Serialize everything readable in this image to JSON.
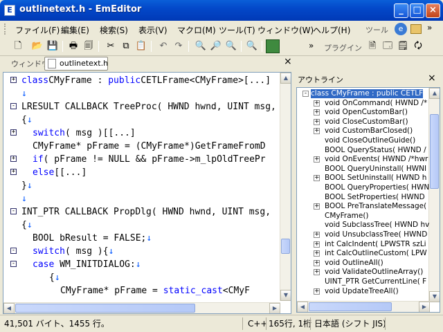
{
  "window": {
    "title": "outlinetext.h - EmEditor"
  },
  "menu": [
    "ファイル(F)",
    "編集(E)",
    "検索(S)",
    "表示(V)",
    "マクロ(M)",
    "ツール(T)",
    "ウィンドウ(W)",
    "ヘルプ(H)"
  ],
  "toolbar_labels": {
    "tool": "ツール",
    "plugin": "プラグイン",
    "more": "»"
  },
  "tabbar": {
    "label": "ウィンドウ",
    "tab": "outlinetext.h",
    "close": "×"
  },
  "outline": {
    "title": "アウトライン",
    "close": "×"
  },
  "code": [
    {
      "fold": "+",
      "parts": [
        [
          "kw",
          "class"
        ],
        [
          "",
          "CMyFrame : "
        ],
        [
          "kw",
          "public"
        ],
        [
          "",
          "CETLFrame<CMyFrame>[...]"
        ]
      ],
      "indent": 0
    },
    {
      "fold": "",
      "parts": [
        [
          "nl",
          "↓"
        ]
      ],
      "indent": 0
    },
    {
      "fold": "-",
      "parts": [
        [
          "",
          "LRESULT CALLBACK TreeProc( HWND hwnd, UINT msg,"
        ]
      ],
      "indent": 0
    },
    {
      "fold": "",
      "parts": [
        [
          "",
          "{"
        ],
        [
          "nl",
          "↓"
        ]
      ],
      "indent": 0
    },
    {
      "fold": "+",
      "parts": [
        [
          "kw",
          "switch"
        ],
        [
          "",
          "( msg )[[...]"
        ]
      ],
      "indent": 2
    },
    {
      "fold": "",
      "parts": [
        [
          "",
          "CMyFrame* pFrame = (CMyFrame*)GetFrameFromD"
        ]
      ],
      "indent": 2
    },
    {
      "fold": "+",
      "parts": [
        [
          "kw",
          "if"
        ],
        [
          "",
          "( pFrame != NULL && pFrame->m_lpOldTreePr"
        ]
      ],
      "indent": 2
    },
    {
      "fold": "+",
      "parts": [
        [
          "kw",
          "else"
        ],
        [
          "",
          "[[...]"
        ]
      ],
      "indent": 2
    },
    {
      "fold": "",
      "parts": [
        [
          "",
          "}"
        ],
        [
          "nl",
          "↓"
        ]
      ],
      "indent": 0
    },
    {
      "fold": "",
      "parts": [
        [
          "nl",
          "↓"
        ]
      ],
      "indent": 0
    },
    {
      "fold": "-",
      "parts": [
        [
          "",
          "INT_PTR CALLBACK PropDlg( HWND hwnd, UINT msg,"
        ]
      ],
      "indent": 0
    },
    {
      "fold": "",
      "parts": [
        [
          "",
          "{"
        ],
        [
          "nl",
          "↓"
        ]
      ],
      "indent": 0
    },
    {
      "fold": "",
      "parts": [
        [
          "",
          "BOOL bResult = FALSE;"
        ],
        [
          "nl",
          "↓"
        ]
      ],
      "indent": 2
    },
    {
      "fold": "-",
      "parts": [
        [
          "kw",
          "switch"
        ],
        [
          "",
          "( msg ){"
        ],
        [
          "nl",
          "↓"
        ]
      ],
      "indent": 2
    },
    {
      "fold": "-",
      "parts": [
        [
          "kw",
          "case"
        ],
        [
          "",
          " WM_INITDIALOG:"
        ],
        [
          "nl",
          "↓"
        ]
      ],
      "indent": 2
    },
    {
      "fold": "",
      "parts": [
        [
          "",
          "{"
        ],
        [
          "nl",
          "↓"
        ]
      ],
      "indent": 5
    },
    {
      "fold": "",
      "parts": [
        [
          "",
          "CMyFrame* pFrame = "
        ],
        [
          "kw",
          "static_cast"
        ],
        [
          "",
          "<CMyF"
        ]
      ],
      "indent": 7
    }
  ],
  "outline_items": [
    {
      "fold": "-",
      "text": "class CMyFrame : public CETLF",
      "level": 0,
      "selected": true
    },
    {
      "fold": "+",
      "text": "void OnCommand( HWND /*",
      "level": 1
    },
    {
      "fold": "+",
      "text": "void OpenCustomBar()",
      "level": 1
    },
    {
      "fold": "+",
      "text": "void CloseCustomBar()",
      "level": 1
    },
    {
      "fold": "+",
      "text": "void CustomBarClosed()",
      "level": 1
    },
    {
      "fold": "",
      "text": "void CloseOutlineGuide()",
      "level": 1
    },
    {
      "fold": "",
      "text": "BOOL QueryStatus( HWND /",
      "level": 1
    },
    {
      "fold": "+",
      "text": "void OnEvents( HWND /*hwr",
      "level": 1
    },
    {
      "fold": "",
      "text": "BOOL QueryUninstall( HWNI",
      "level": 1
    },
    {
      "fold": "+",
      "text": "BOOL SetUninstall( HWND h",
      "level": 1
    },
    {
      "fold": "",
      "text": "BOOL QueryProperties( HWN",
      "level": 1
    },
    {
      "fold": "",
      "text": "BOOL SetProperties( HWND",
      "level": 1
    },
    {
      "fold": "+",
      "text": "BOOL PreTranslateMessage(",
      "level": 1
    },
    {
      "fold": "",
      "text": "CMyFrame()",
      "level": 1
    },
    {
      "fold": "",
      "text": "void SubclassTree( HWND hv",
      "level": 1
    },
    {
      "fold": "+",
      "text": "void UnsubclassTree( HWND",
      "level": 1
    },
    {
      "fold": "+",
      "text": "int CalcIndent( LPWSTR szLi",
      "level": 1
    },
    {
      "fold": "+",
      "text": "int CalcOutlineCustom( LPW",
      "level": 1
    },
    {
      "fold": "+",
      "text": "void OutlineAll()",
      "level": 1
    },
    {
      "fold": "+",
      "text": "void ValidateOutlineArray()",
      "level": 1
    },
    {
      "fold": "",
      "text": "UINT_PTR GetCurrentLine( F",
      "level": 1
    },
    {
      "fold": "+",
      "text": "void UpdateTreeAll()",
      "level": 1
    }
  ],
  "status": {
    "size": "41,501 バイト、1455 行。",
    "mode": "C++",
    "position": "165行, 1桁",
    "encoding": "日本語 (シフト JIS)"
  }
}
